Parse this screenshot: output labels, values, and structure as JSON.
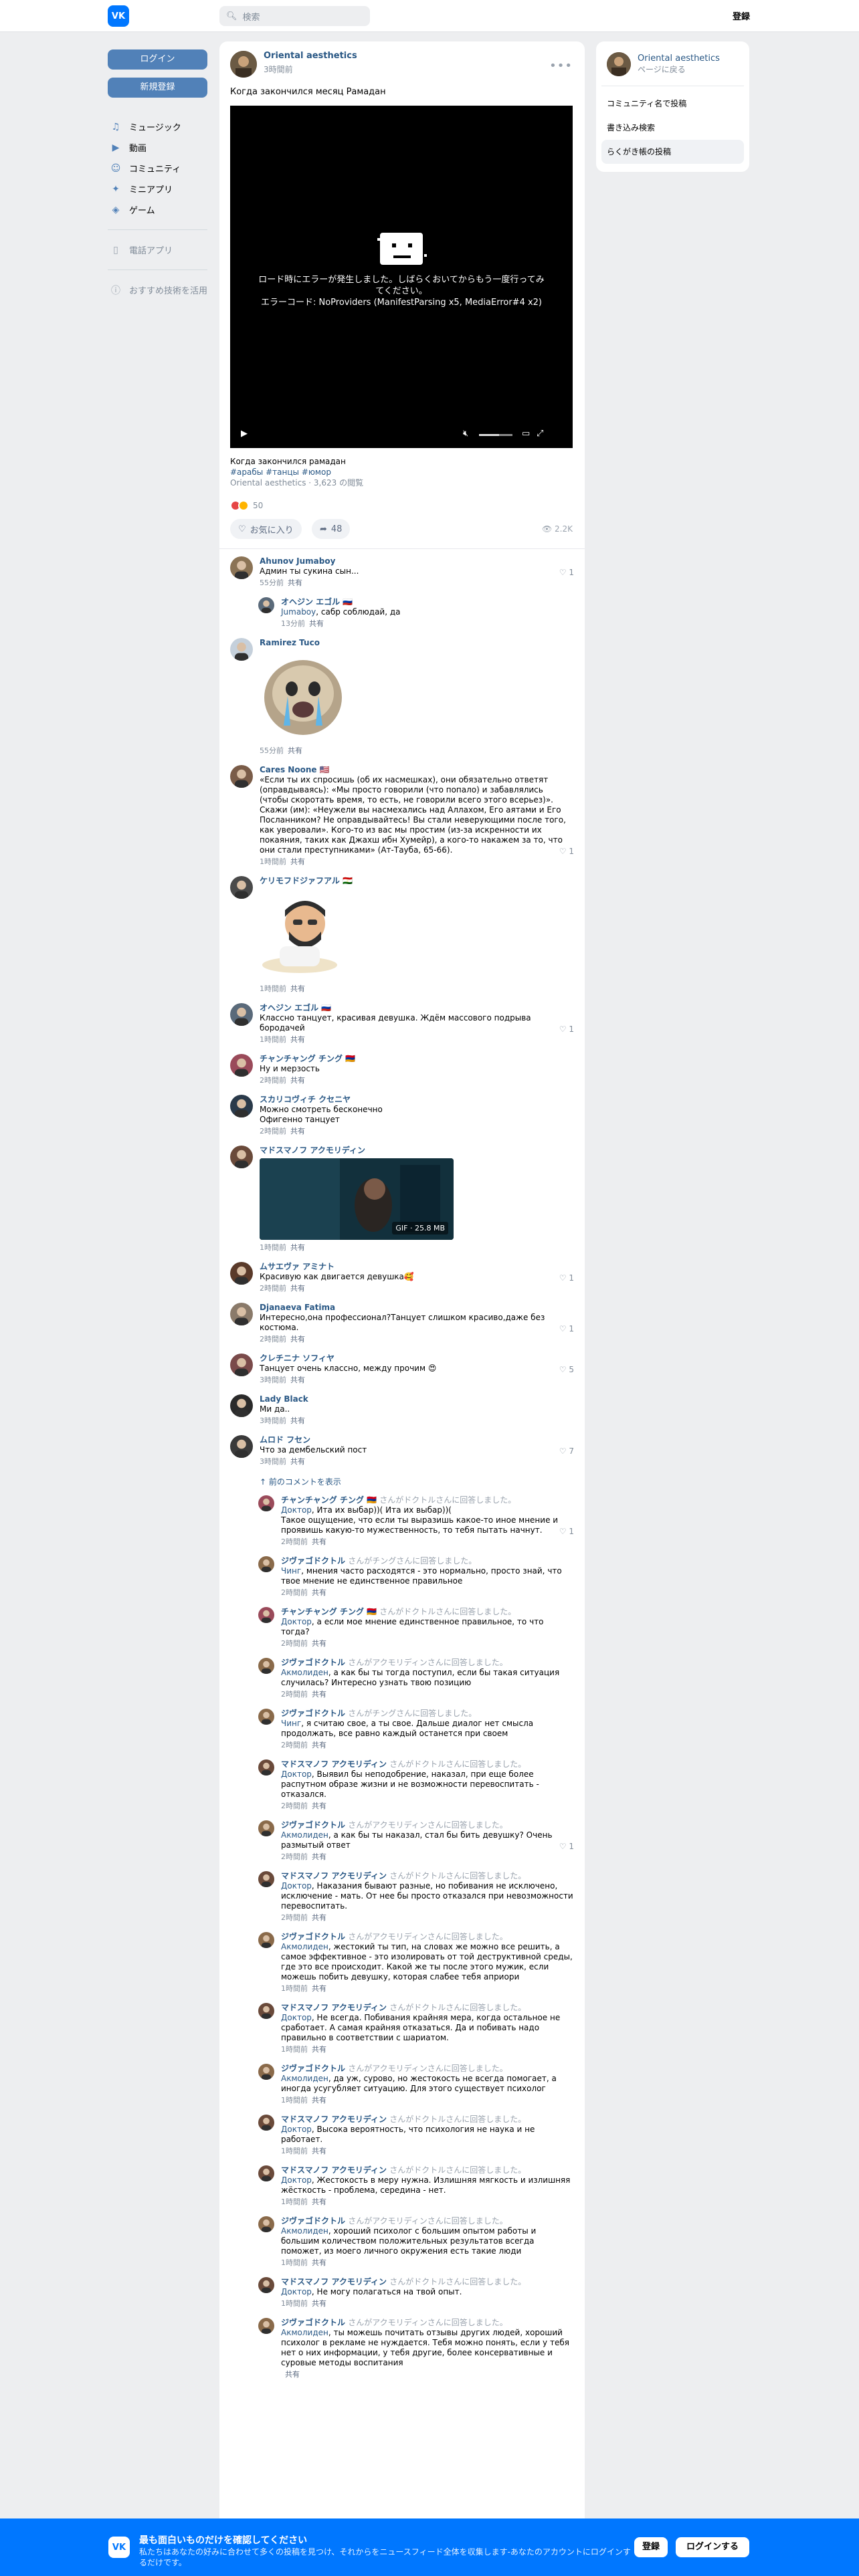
{
  "topbar": {
    "logo": "VK",
    "search_placeholder": "検索",
    "register": "登録"
  },
  "left": {
    "login": "ログイン",
    "signup": "新規登録",
    "nav": [
      {
        "icon": "music-icon",
        "glyph": "♫",
        "label": "ミュージック"
      },
      {
        "icon": "video-icon",
        "glyph": "▶",
        "label": "動画"
      },
      {
        "icon": "community-icon",
        "glyph": "☺",
        "label": "コミュニティ"
      },
      {
        "icon": "miniapp-icon",
        "glyph": "✦",
        "label": "ミニアプリ"
      },
      {
        "icon": "game-icon",
        "glyph": "◈",
        "label": "ゲーム"
      }
    ],
    "mobile": "電話アプリ",
    "about": "おすすめ技術を活用"
  },
  "post": {
    "author": "Oriental aesthetics",
    "time": "3時間前",
    "text": "Когда закончился месяц Рамадан",
    "video_error": "ロード時にエラーが発生しました。しばらくおいてからもう一度行ってみてください。",
    "video_code": "エラーコード: NoProviders (ManifestParsing x5, MediaError#4 x2)",
    "caption_title": "Когда закончился рамадан",
    "caption_tags": "#арабы #танцы #юмор",
    "caption_meta": "Oriental aesthetics · 3,623 の閲覧",
    "reactions_count": "50",
    "like_label": "お気に入り",
    "share_count": "48",
    "views": "2.2K"
  },
  "comments": [
    {
      "name": "Ahunov Jumaboy",
      "text": "Админ ты сукина сын...",
      "time": "55分前",
      "reply": "共有",
      "likes": "1",
      "av": "#8b7355"
    },
    {
      "name": "オヘジン エゴル 🇷🇺",
      "to": "",
      "mention": "Jumaboy",
      "text": ", сабр соблюдай, да",
      "time": "13分前",
      "reply": "共有",
      "likes": "",
      "av": "#5a6a7a",
      "child": true
    },
    {
      "name": "Ramirez Tuco",
      "text": "",
      "time": "55分前",
      "reply": "共有",
      "likes": "",
      "av": "#c5d0db",
      "sticker": "seal"
    },
    {
      "name": "Cares Noone 🇺🇸",
      "text": "«Если ты их спросишь (об их насмешках), они обязательно ответят (оправдываясь): «Мы просто говорили (что попало) и забавлялись (чтобы скоротать время, то есть, не говорили всего этого всерьез)». Скажи (им): «Неужели вы насмехались над Аллахом, Его аятами и Его Посланником? Не оправдывайтесь! Вы стали неверующими после того, как уверовали». Кого-то из вас мы простим (из-за искренности их покаяния, таких как Джахш ибн Хумейр), а кого-то накажем за то, что они стали преступниками» (Ат-Тауба, 65-66).",
      "time": "1時間前",
      "reply": "共有",
      "likes": "1",
      "av": "#7a5c48"
    },
    {
      "name": "ケリモフドジァフアル 🇹🇯",
      "text": "",
      "time": "1時間前",
      "reply": "共有",
      "likes": "",
      "av": "#4a4a4a",
      "sticker": "man"
    },
    {
      "name": "オヘジン エゴル 🇷🇺",
      "text": "Классно танцует, красивая девушка. Ждём массового подрыва бородачей",
      "time": "1時間前",
      "reply": "共有",
      "likes": "1",
      "av": "#5a6a7a"
    },
    {
      "name": "チャンチャング チング 🇦🇲",
      "text": "Ну и мерзость",
      "time": "2時間前",
      "reply": "共有",
      "likes": "",
      "av": "#9a4a5a"
    },
    {
      "name": "スカリコヴィチ クセニヤ",
      "text": "Можно смотреть бесконечно\nОфигенно танцует",
      "time": "2時間前",
      "reply": "共有",
      "likes": "",
      "av": "#2a3a4a"
    },
    {
      "name": "マドスマノフ アクモリディン",
      "text": "",
      "time": "1時間前",
      "reply": "共有",
      "likes": "",
      "av": "#6a4a3a",
      "gif": "GIF · 25.8 MB"
    },
    {
      "name": "ムサエヴァ アミナト",
      "text": "Красивую как двигается девушка🥰",
      "time": "2時間前",
      "reply": "共有",
      "likes": "1",
      "av": "#5a3a2a"
    },
    {
      "name": "Djanaeva Fatima",
      "text": "Интересно,она профессионал?Танцует слишком красиво,даже без костюма.",
      "time": "2時間前",
      "reply": "共有",
      "likes": "1",
      "av": "#8a7a6a"
    },
    {
      "name": "クレチニナ ソフィヤ",
      "text": "Танцует очень классно, между прочим 😍",
      "time": "3時間前",
      "reply": "共有",
      "likes": "5",
      "av": "#7a4a4a"
    },
    {
      "name": "Lady Black",
      "text": "Ми да..",
      "time": "3時間前",
      "reply": "共有",
      "likes": "",
      "av": "#2a2a2a"
    },
    {
      "name": "ムロド フセン",
      "text": "Что за дембельский пост",
      "time": "3時間前",
      "reply": "共有",
      "likes": "7",
      "av": "#3a3a3a"
    }
  ],
  "prev_label": "前のコメントを表示",
  "replies": [
    {
      "name": "チャンチャング チング 🇦🇲",
      "to": "さんがドクトルさんに回答しました。",
      "mention": "Доктор",
      "text": ", Ита их выбар))( Ита их выбар))(\nТакое ощущение, что если ты выразишь какое-то иное мнение и проявишь какую-то мужественность, то тебя пытать начнут.",
      "time": "2時間前",
      "likes": "1",
      "av": "#9a4a5a"
    },
    {
      "name": "ジヴァゴドクトル",
      "to": "さんがチングさんに回答しました。",
      "mention": "Чинг",
      "text": ", мнения часто расходятся - это нормально, просто знай, что твое мнение не единственное правильное",
      "time": "2時間前",
      "likes": "",
      "av": "#8a6a4a"
    },
    {
      "name": "チャンチャング チング 🇦🇲",
      "to": "さんがドクトルさんに回答しました。",
      "mention": "Доктор",
      "text": ", а если мое мнение единственное правильное, то что тогда?",
      "time": "2時間前",
      "likes": "",
      "av": "#9a4a5a"
    },
    {
      "name": "ジヴァゴドクトル",
      "to": "さんがアクモリディンさんに回答しました。",
      "mention": "Акмолиден",
      "text": ", а как бы ты тогда поступил, если бы такая ситуация случилась? Интересно узнать твою позицию",
      "time": "2時間前",
      "likes": "",
      "av": "#8a6a4a"
    },
    {
      "name": "ジヴァゴドクトル",
      "to": "さんがチングさんに回答しました。",
      "mention": "Чинг",
      "text": ", я считаю свое, а ты свое. Дальше диалог нет смысла продолжать, все равно каждый останется при своем",
      "time": "2時間前",
      "likes": "",
      "av": "#8a6a4a"
    },
    {
      "name": "マドスマノフ アクモリディン",
      "to": "さんがドクトルさんに回答しました。",
      "mention": "Доктор",
      "text": ", Выявил бы неподобрение, наказал, при еще более распутном образе жизни и не возможности перевоспитать - отказался.",
      "time": "2時間前",
      "likes": "",
      "av": "#6a4a3a"
    },
    {
      "name": "ジヴァゴドクトル",
      "to": "さんがアクモリディンさんに回答しました。",
      "mention": "Акмолиден",
      "text": ", а как бы ты наказал, стал бы бить девушку? Очень размытый ответ",
      "time": "2時間前",
      "likes": "1",
      "av": "#8a6a4a"
    },
    {
      "name": "マドスマノフ アクモリディン",
      "to": "さんがドクトルさんに回答しました。",
      "mention": "Доктор",
      "text": ", Наказания бывают разные, но побивания не исключено, исключение - мать. От нее бы просто отказался при невозможности перевоспитать.",
      "time": "2時間前",
      "likes": "",
      "av": "#6a4a3a"
    },
    {
      "name": "ジヴァゴドクトル",
      "to": "さんがアクモリディンさんに回答しました。",
      "mention": "Акмолиден",
      "text": ", жестокий ты тип, на словах же можно все решить, а самое эффективное - это изолировать от той деструктивной среды, где это все происходит. Какой же ты после этого мужик, если можешь побить девушку, которая слабее тебя априори",
      "time": "1時間前",
      "likes": "",
      "av": "#8a6a4a"
    },
    {
      "name": "マドスマノフ アクモリディン",
      "to": "さんがドクトルさんに回答しました。",
      "mention": "Доктор",
      "text": ", Не всегда. Побивания крайняя мера, когда остальное не сработает. А самая крайняя отказаться. Да и побивать надо правильно в соответствии с шариатом.",
      "time": "1時間前",
      "likes": "",
      "av": "#6a4a3a"
    },
    {
      "name": "ジヴァゴドクトル",
      "to": "さんがアクモリディンさんに回答しました。",
      "mention": "Акмолиден",
      "text": ", да уж, сурово, но жестокость не всегда помогает, а иногда усугубляет ситуацию. Для этого существует психолог",
      "time": "1時間前",
      "likes": "",
      "av": "#8a6a4a"
    },
    {
      "name": "マドスマノフ アクモリディン",
      "to": "さんがドクトルさんに回答しました。",
      "mention": "Доктор",
      "text": ", Высока вероятность, что психология не наука и не работает.",
      "time": "1時間前",
      "likes": "",
      "av": "#6a4a3a"
    },
    {
      "name": "マドスマノフ アクモリディン",
      "to": "さんがドクトルさんに回答しました。",
      "mention": "Доктор",
      "text": ", Жестокость в меру нужна. Излишняя мягкость и излишняя жёсткость - проблема, середина - нет.",
      "time": "1時間前",
      "likes": "",
      "av": "#6a4a3a"
    },
    {
      "name": "ジヴァゴドクトル",
      "to": "さんがアクモリディンさんに回答しました。",
      "mention": "Акмолиден",
      "text": ", хороший психолог с большим опытом работы и большим количеством положительных результатов всегда поможет, из моего личного окружения есть такие люди",
      "time": "1時間前",
      "likes": "",
      "av": "#8a6a4a"
    },
    {
      "name": "マドスマノフ アクモリディン",
      "to": "さんがドクトルさんに回答しました。",
      "mention": "Доктор",
      "text": ", Не могу полагаться на твой опыт.",
      "time": "1時間前",
      "likes": "",
      "av": "#6a4a3a"
    },
    {
      "name": "ジヴァゴドクトル",
      "to": "さんがアクモリディンさんに回答しました。",
      "mention": "Акмолиден",
      "text": ", ты можешь почитать отзывы других людей, хороший психолог в рекламе не нуждается. Тебя можно понять, если у тебя нет о них информации, у тебя другие, более консервативные и суровые методы воспитания",
      "time": "",
      "likes": "",
      "av": "#8a6a4a"
    }
  ],
  "right": {
    "name": "Oriental aesthetics",
    "sub": "ページに戻る",
    "items": [
      "コミュニティ名で投稿",
      "書き込み検索",
      "らくがき帳の投稿"
    ]
  },
  "banner": {
    "title": "最も面白いものだけを確認してください",
    "sub": "私たちはあなたの好みに合わせて多くの投稿を見つけ、それからをニュースフィード全体を収集します-あなたのアカウントにログインするだけです。",
    "register": "登録",
    "login": "ログインする"
  },
  "colors": {
    "brand": "#0077ff",
    "button": "#5181b8",
    "link": "#2a5885"
  }
}
